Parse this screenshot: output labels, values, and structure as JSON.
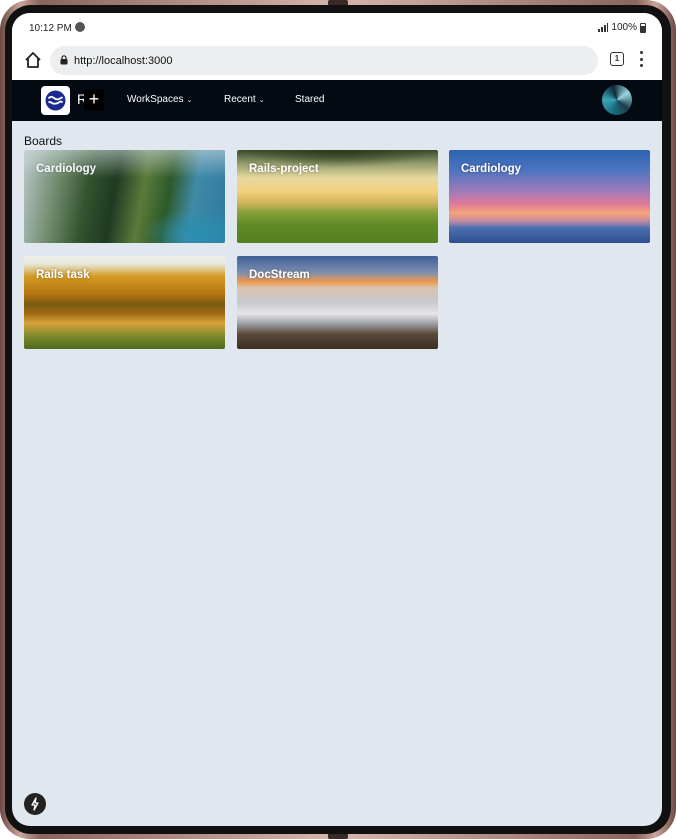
{
  "status_bar": {
    "time": "10:12 PM",
    "battery": "100%"
  },
  "browser": {
    "url": "http://localhost:3000",
    "tab_count": "1"
  },
  "app_nav": {
    "brand_letter": "R",
    "add_label": "+",
    "menu": [
      {
        "label": "WorkSpaces",
        "has_dropdown": true
      },
      {
        "label": "Recent",
        "has_dropdown": true
      },
      {
        "label": "Stared",
        "has_dropdown": false
      }
    ]
  },
  "content": {
    "section_title": "Boards",
    "boards": [
      {
        "title": "Cardiology"
      },
      {
        "title": "Rails-project"
      },
      {
        "title": "Cardiology"
      },
      {
        "title": "Rails task"
      },
      {
        "title": "DocStream"
      }
    ]
  },
  "icons": {
    "home": "home-icon",
    "lock": "lock-icon",
    "tabs": "tabs-icon",
    "menu": "more-vert-icon",
    "logo": "app-logo-icon",
    "bolt": "bolt-icon"
  }
}
